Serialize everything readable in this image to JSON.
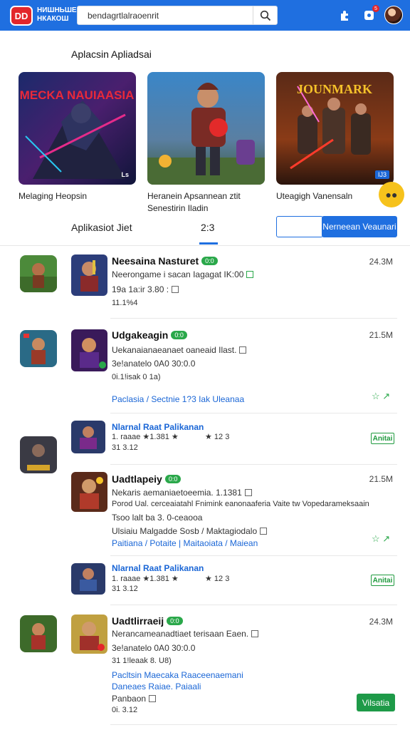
{
  "header": {
    "logo_text": "DD",
    "brand_line1": "НИШНЬШЕ",
    "brand_line2": "НКАКОШ",
    "search_value": "bendagrtlalraoenrit",
    "notification_count": "5"
  },
  "featured": {
    "section_title": "Aplacsin   Apliadsai",
    "cards": [
      {
        "art_title": "MECKA NAUIAASIA",
        "tag": "Ls",
        "label": "Melaging Heopsin"
      },
      {
        "art_title": "",
        "tag": "",
        "label": "Heranein Apsannean ztit Senestirin Iladin"
      },
      {
        "art_title": "JOUNMARK",
        "tag": "IJ3",
        "label": "Uteagigh Vanensaln"
      }
    ]
  },
  "tabs": {
    "left": "Aplikasiot Jiet",
    "center": "2:3",
    "button_primary": "Nerneean Veaunari",
    "button_outline": ""
  },
  "list": [
    {
      "name": "Neesaina Nasturet",
      "pill": "0:0",
      "line1": "Neerongame i sacan Iagagat IK:00",
      "line2": "19a 1a:ir 3.80 :",
      "line3": "11.1%4",
      "size": "24.3M"
    },
    {
      "name": "Udgakeagin",
      "pill": "0:0",
      "line1": "Uekanaianaeanaet oaneaid Ilast.",
      "line2": "3e!anatelo 0A0 30:0.0",
      "line3": "0i.1!isak 0 1a)",
      "link": "Paclasia / Sectnie 1?3 Iak Uleanaa",
      "size": "21.5M"
    },
    {
      "title": "Nlarnal Raat Palikanan",
      "line1": "1. raaae ★1.381  ★",
      "line1b": "★ 12  3",
      "line2": "31 3.12",
      "button": "Anitai"
    },
    {
      "name": "Uadtlapeiy",
      "pill": "0:0",
      "line1": "Nekaris aemaniaetoeemia. 1.1381",
      "line2": "Porod Ual. cerceaiatahl  Fnimink eanonaaferia Vaite  tw Vopedarameksaain",
      "line3": "Tsoo lalt ba 3.  0-ceaooa",
      "line4": "Ulsiaiu  Malgadde Sosb  / Maktagiodalo",
      "link": "Paitiana / Potaite  | Maitaoiata / Maiean",
      "size": "21.5M"
    },
    {
      "title": "Nlarnal Raat Palikanan",
      "line1": "1. raaae ★1.381  ★",
      "line1b": "★ 12  3",
      "line2": "31 3.12",
      "button": "Anitai"
    },
    {
      "name": "Uadtlirraeij",
      "pill": "0:0",
      "line1": "Nerancameanadtiaet terisaan Eaen.",
      "line2": "3e!anatelo 0A0 30:0.0",
      "line3": "31 1!leaak 8. U8)",
      "link1": "Pacltsin Maecaka  Raaceenaemani",
      "link2": "Daneaes Raiae. Paiaali",
      "line4": "Panbaon",
      "line5": "0i. 3.12",
      "size": "24.3M",
      "button": "Vilsatia"
    }
  ]
}
